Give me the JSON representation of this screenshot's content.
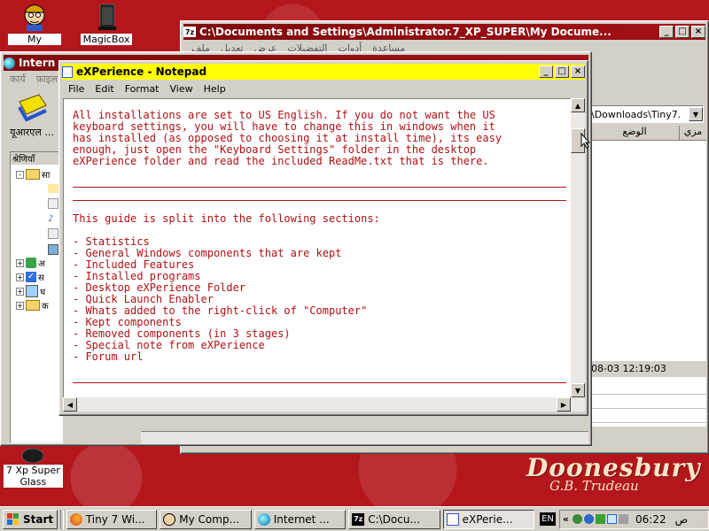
{
  "desktop": {
    "icons": [
      {
        "label": "My\nComputer",
        "icon": "my-computer-icon"
      },
      {
        "label": "MagicBox",
        "icon": "magicbox-icon"
      },
      {
        "label": "7 Xp Super\nGlass",
        "icon": "glass-icon"
      }
    ],
    "wallpaper_text": {
      "title": "Doonesbury",
      "signature": "G.B. Trudeau"
    }
  },
  "explorer_window": {
    "title": "C:\\Documents and Settings\\Administrator.7_XP_SUPER\\My Docume...",
    "menu": [
      "ملف",
      "تعديل",
      "عرض",
      "التفضيلات",
      "أدوات",
      "مساعدة"
    ],
    "address": "\\Downloads\\Tiny7.",
    "columns": [
      "الوضع",
      "مزي"
    ],
    "date_text": "08-03 12:19:03"
  },
  "ie_window": {
    "title": "Intern",
    "menu": [
      "कार्य",
      "फ़ाइल"
    ],
    "toolbar_label": "यूआरएल ...",
    "folders_header": "श्रेणियाँ",
    "tree_items": [
      "सा",
      "अ",
      "स",
      "ध",
      "क"
    ]
  },
  "notepad": {
    "title": "eXPerience - Notepad",
    "menu": [
      "File",
      "Edit",
      "Format",
      "View",
      "Help"
    ],
    "lines": [
      "All installations are set to US English. If you do not want the US",
      "keyboard settings, you will have to change this in windows when it",
      "has installed (as opposed to choosing it at install time), its easy",
      "enough, just open the \"Keyboard Settings\" folder in the desktop",
      "eXPerience folder and read the included ReadMe.txt that is there.",
      "",
      "",
      "",
      "",
      "This guide is split into the following sections:",
      "",
      "- Statistics",
      "- General Windows components that are kept",
      "- Included Features",
      "- Installed programs",
      "- Desktop eXPerience Folder",
      "- Quick Launch Enabler",
      "- Whats added to the right-click of \"Computer\"",
      "- Kept components",
      "- Removed components (in 3 stages)",
      "- Special note from eXPerience",
      "- Forum url"
    ]
  },
  "taskbar": {
    "start_label": "Start",
    "buttons": [
      {
        "label": "Tiny 7 Wi...",
        "icon": "firefox-icon"
      },
      {
        "label": "My Comp...",
        "icon": "my-computer-icon"
      },
      {
        "label": "Internet ...",
        "icon": "internet-icon"
      },
      {
        "label": "C:\\Docu...",
        "icon": "7zip-icon"
      },
      {
        "label": "eXPerie...",
        "icon": "notepad-icon",
        "active": true
      }
    ],
    "lang": "EN",
    "chevron": "«",
    "clock": "06:22",
    "ampm": "ص"
  }
}
